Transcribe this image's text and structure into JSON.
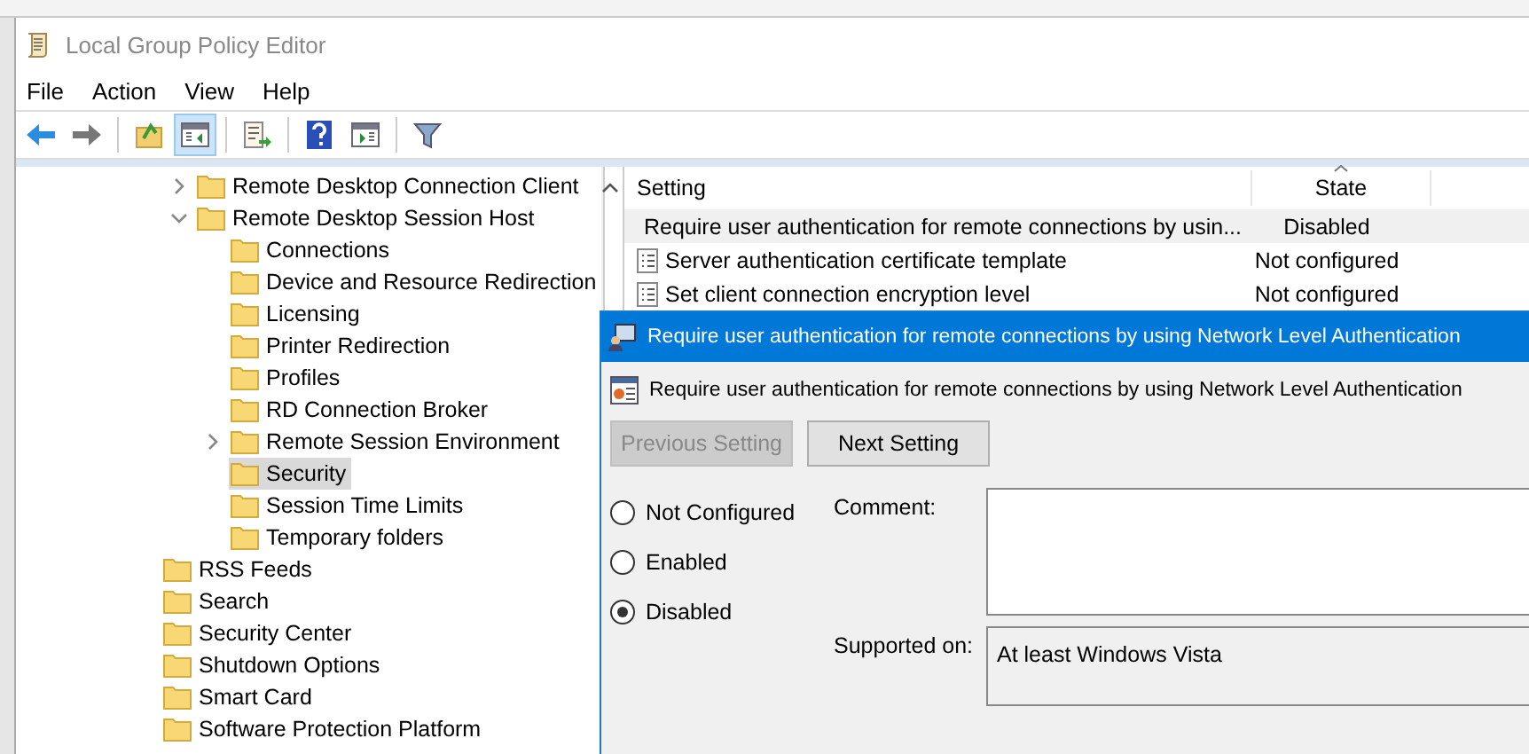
{
  "window": {
    "title": "Local Group Policy Editor"
  },
  "menu": [
    "File",
    "Action",
    "View",
    "Help"
  ],
  "toolbar": [
    {
      "kind": "back",
      "pressed": false
    },
    {
      "kind": "forward",
      "pressed": false
    },
    {
      "kind": "sep"
    },
    {
      "kind": "up",
      "pressed": false
    },
    {
      "kind": "tree",
      "pressed": true
    },
    {
      "kind": "sep"
    },
    {
      "kind": "export",
      "pressed": false
    },
    {
      "kind": "sep"
    },
    {
      "kind": "help",
      "pressed": false
    },
    {
      "kind": "pane",
      "pressed": false
    },
    {
      "kind": "sep"
    },
    {
      "kind": "filter",
      "pressed": false
    }
  ],
  "tree": {
    "scrolled_branch": [
      {
        "label": "Remote Desktop Connection Client",
        "kind": "collapsed",
        "selected": false
      },
      {
        "label": "Remote Desktop Session Host",
        "kind": "expanded",
        "selected": false,
        "children": [
          {
            "label": "Connections",
            "kind": "leaf",
            "selected": false
          },
          {
            "label": "Device and Resource Redirection",
            "kind": "leaf",
            "selected": false
          },
          {
            "label": "Licensing",
            "kind": "leaf",
            "selected": false
          },
          {
            "label": "Printer Redirection",
            "kind": "leaf",
            "selected": false
          },
          {
            "label": "Profiles",
            "kind": "leaf",
            "selected": false
          },
          {
            "label": "RD Connection Broker",
            "kind": "leaf",
            "selected": false
          },
          {
            "label": "Remote Session Environment",
            "kind": "collapsed",
            "selected": false
          },
          {
            "label": "Security",
            "kind": "leaf",
            "selected": true
          },
          {
            "label": "Session Time Limits",
            "kind": "leaf",
            "selected": false
          },
          {
            "label": "Temporary folders",
            "kind": "leaf",
            "selected": false
          }
        ]
      }
    ],
    "items": [
      {
        "label": "RSS Feeds",
        "selected": false
      },
      {
        "label": "Search",
        "selected": false
      },
      {
        "label": "Security Center",
        "selected": false
      },
      {
        "label": "Shutdown Options",
        "selected": false
      },
      {
        "label": "Smart Card",
        "selected": false
      },
      {
        "label": "Software Protection Platform",
        "selected": false
      }
    ]
  },
  "table": {
    "columns": [
      "Setting",
      "State"
    ],
    "rows": [
      {
        "setting": "Require user authentication for remote connections by usin...",
        "state": "Disabled",
        "selected": true,
        "kind": "edited"
      },
      {
        "setting": "Server authentication certificate template",
        "state": "Not configured",
        "selected": false,
        "kind": "plain"
      },
      {
        "setting": "Set client connection encryption level",
        "state": "Not configured",
        "selected": false,
        "kind": "plain"
      }
    ]
  },
  "dialog": {
    "title": "Require user authentication for remote connections by using Network Level Authentication",
    "heading": "Require user authentication for remote connections by using Network Level Authentication",
    "buttons": [
      {
        "label": "Previous Setting",
        "disabled": true
      },
      {
        "label": "Next Setting",
        "disabled": false
      }
    ],
    "options": [
      {
        "label": "Not Configured",
        "selected": false
      },
      {
        "label": "Enabled",
        "selected": false
      },
      {
        "label": "Disabled",
        "selected": true
      }
    ],
    "comment_label": "Comment:",
    "supported_label": "Supported on:",
    "supported_value": "At least Windows Vista"
  }
}
